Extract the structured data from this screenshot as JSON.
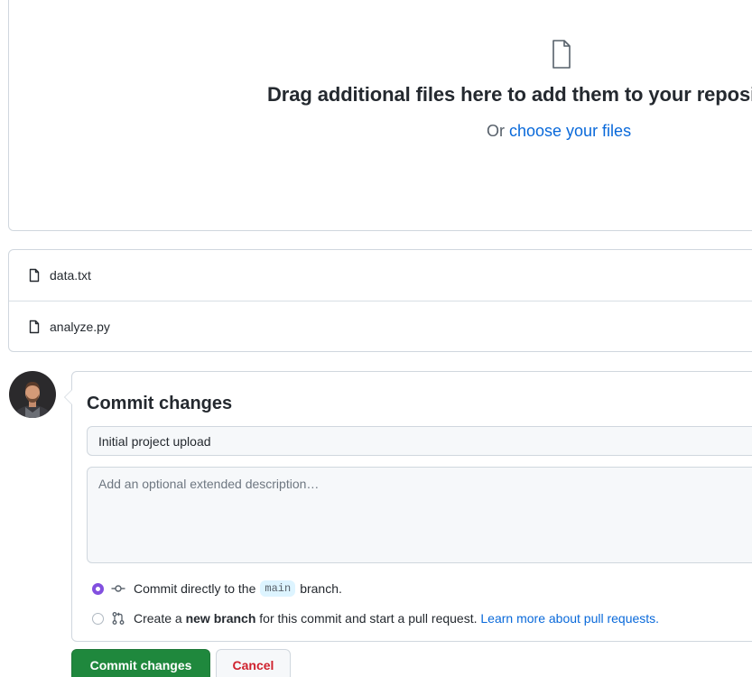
{
  "dropzone": {
    "icon": "file-icon",
    "title": "Drag additional files here to add them to your repository",
    "subtitle_prefix": "Or ",
    "subtitle_link": "choose your files"
  },
  "files": [
    {
      "name": "data.txt",
      "icon": "file-icon"
    },
    {
      "name": "analyze.py",
      "icon": "file-icon"
    }
  ],
  "commit": {
    "title": "Commit changes",
    "summary_value": "Initial project upload",
    "description_placeholder": "Add an optional extended description…",
    "options": {
      "direct": {
        "prefix": "Commit directly to the",
        "branch": "main",
        "suffix": "branch.",
        "checked": true,
        "icon": "git-commit-icon"
      },
      "new_branch": {
        "prefix": "Create a",
        "bold": "new branch",
        "suffix": "for this commit and start a pull request.",
        "link": "Learn more about pull requests.",
        "checked": false,
        "icon": "git-pull-request-icon"
      }
    }
  },
  "buttons": {
    "commit_label": "Commit changes",
    "cancel_label": "Cancel"
  },
  "colors": {
    "primary_button": "#1f883d",
    "link": "#0969da",
    "radio_checked": "#8250df",
    "cancel_text": "#cf222e"
  }
}
